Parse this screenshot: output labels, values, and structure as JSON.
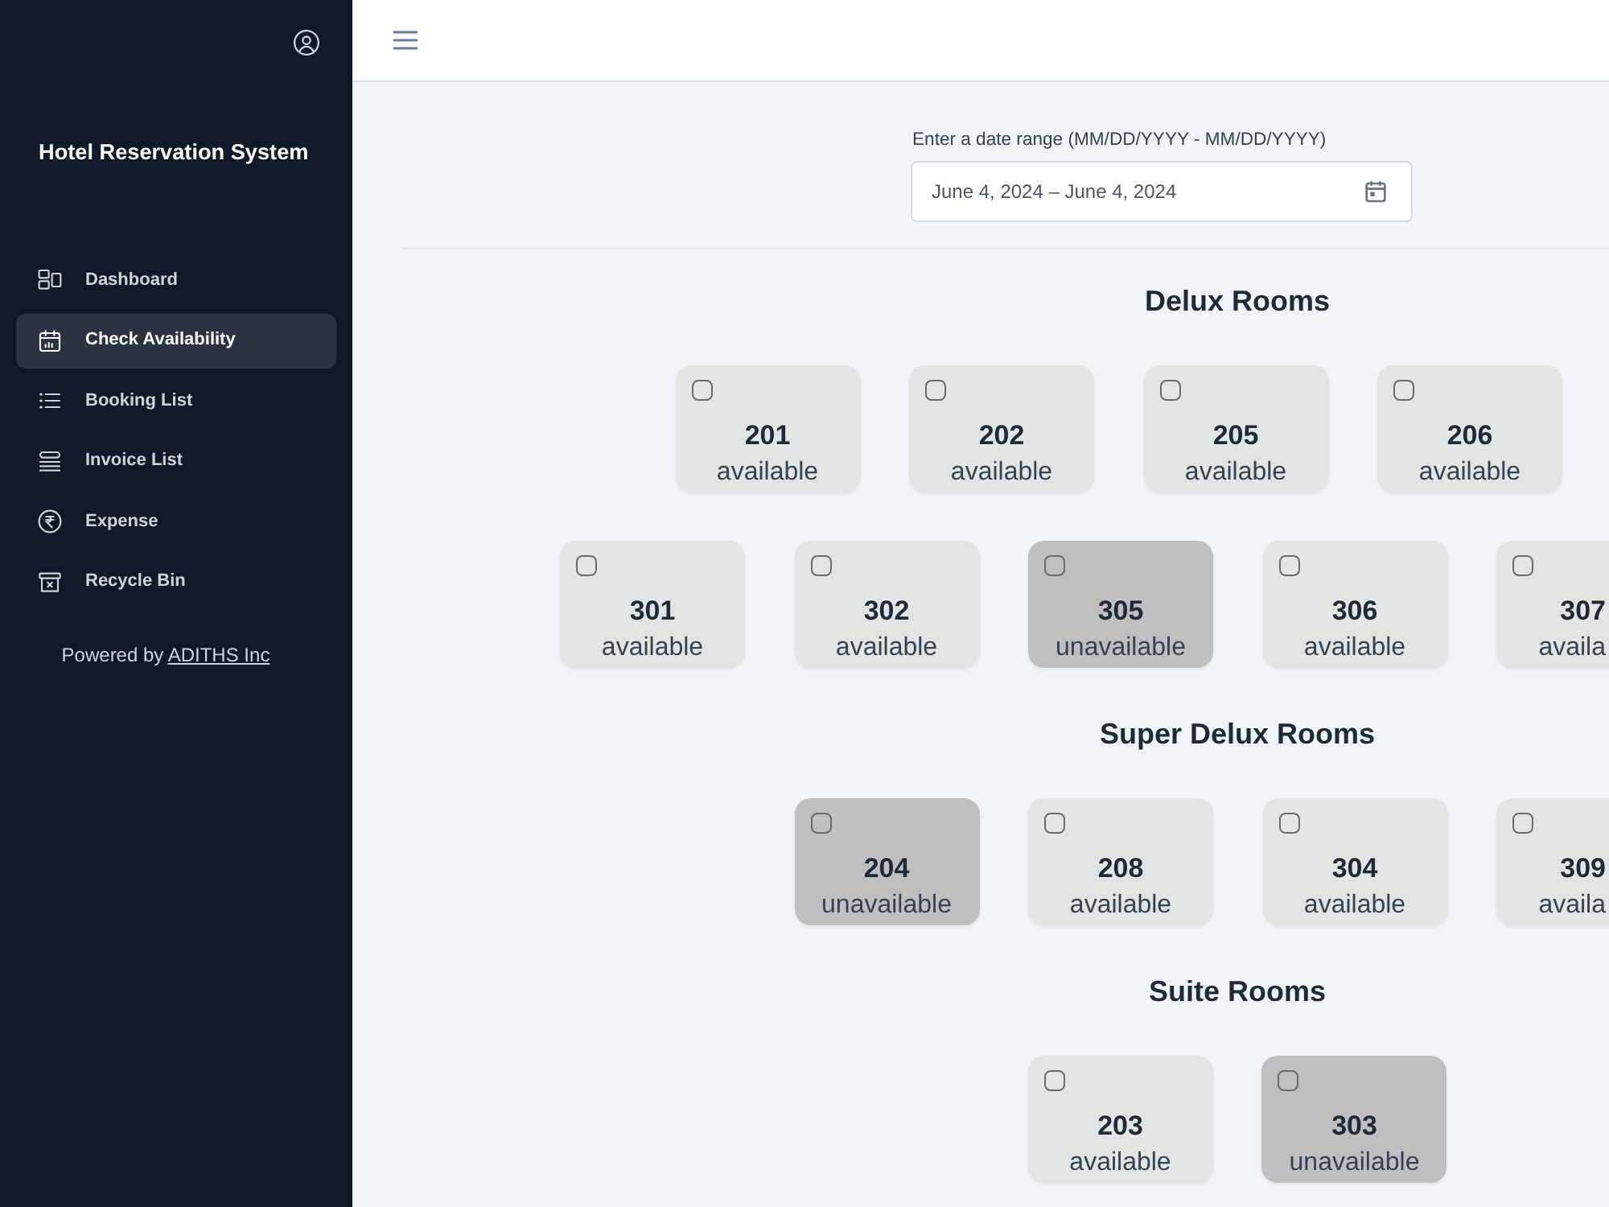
{
  "sidebar": {
    "title": "Hotel Reservation System",
    "items": [
      {
        "label": "Dashboard",
        "selected": false
      },
      {
        "label": "Check Availability",
        "selected": true
      },
      {
        "label": "Booking List",
        "selected": false
      },
      {
        "label": "Invoice List",
        "selected": false
      },
      {
        "label": "Expense",
        "selected": false
      },
      {
        "label": "Recycle Bin",
        "selected": false
      }
    ],
    "powered_by": {
      "text": "Powered by",
      "link": "ADITHS Inc"
    }
  },
  "date_range": {
    "label": "Enter a date range (MM/DD/YYYY - MM/DD/YYYY)",
    "value": "June 4, 2024 – June 4, 2024"
  },
  "sections": [
    {
      "title": "Delux Rooms",
      "rows": [
        [
          {
            "number": "201",
            "status": "available",
            "available": true,
            "checked": false,
            "clipped": false
          },
          {
            "number": "202",
            "status": "available",
            "available": true,
            "checked": false,
            "clipped": false
          },
          {
            "number": "205",
            "status": "available",
            "available": true,
            "checked": false,
            "clipped": false
          },
          {
            "number": "206",
            "status": "available",
            "available": true,
            "checked": false,
            "clipped": false
          }
        ],
        [
          {
            "number": "301",
            "status": "available",
            "available": true,
            "checked": false,
            "clipped": false
          },
          {
            "number": "302",
            "status": "available",
            "available": true,
            "checked": false,
            "clipped": false
          },
          {
            "number": "305",
            "status": "unavailable",
            "available": false,
            "checked": false,
            "clipped": false
          },
          {
            "number": "306",
            "status": "available",
            "available": true,
            "checked": false,
            "clipped": false
          },
          {
            "number": "307",
            "status": "availa",
            "available": true,
            "checked": false,
            "clipped": true
          }
        ]
      ]
    },
    {
      "title": "Super Delux Rooms",
      "rows": [
        [
          {
            "number": "204",
            "status": "unavailable",
            "available": false,
            "checked": false,
            "clipped": false
          },
          {
            "number": "208",
            "status": "available",
            "available": true,
            "checked": false,
            "clipped": false
          },
          {
            "number": "304",
            "status": "available",
            "available": true,
            "checked": false,
            "clipped": false
          },
          {
            "number": "309",
            "status": "availa",
            "available": true,
            "checked": false,
            "clipped": true
          }
        ]
      ]
    },
    {
      "title": "Suite Rooms",
      "rows": [
        [
          {
            "number": "203",
            "status": "available",
            "available": true,
            "checked": false,
            "clipped": false
          },
          {
            "number": "303",
            "status": "unavailable",
            "available": false,
            "checked": false,
            "clipped": false
          }
        ]
      ]
    }
  ]
}
